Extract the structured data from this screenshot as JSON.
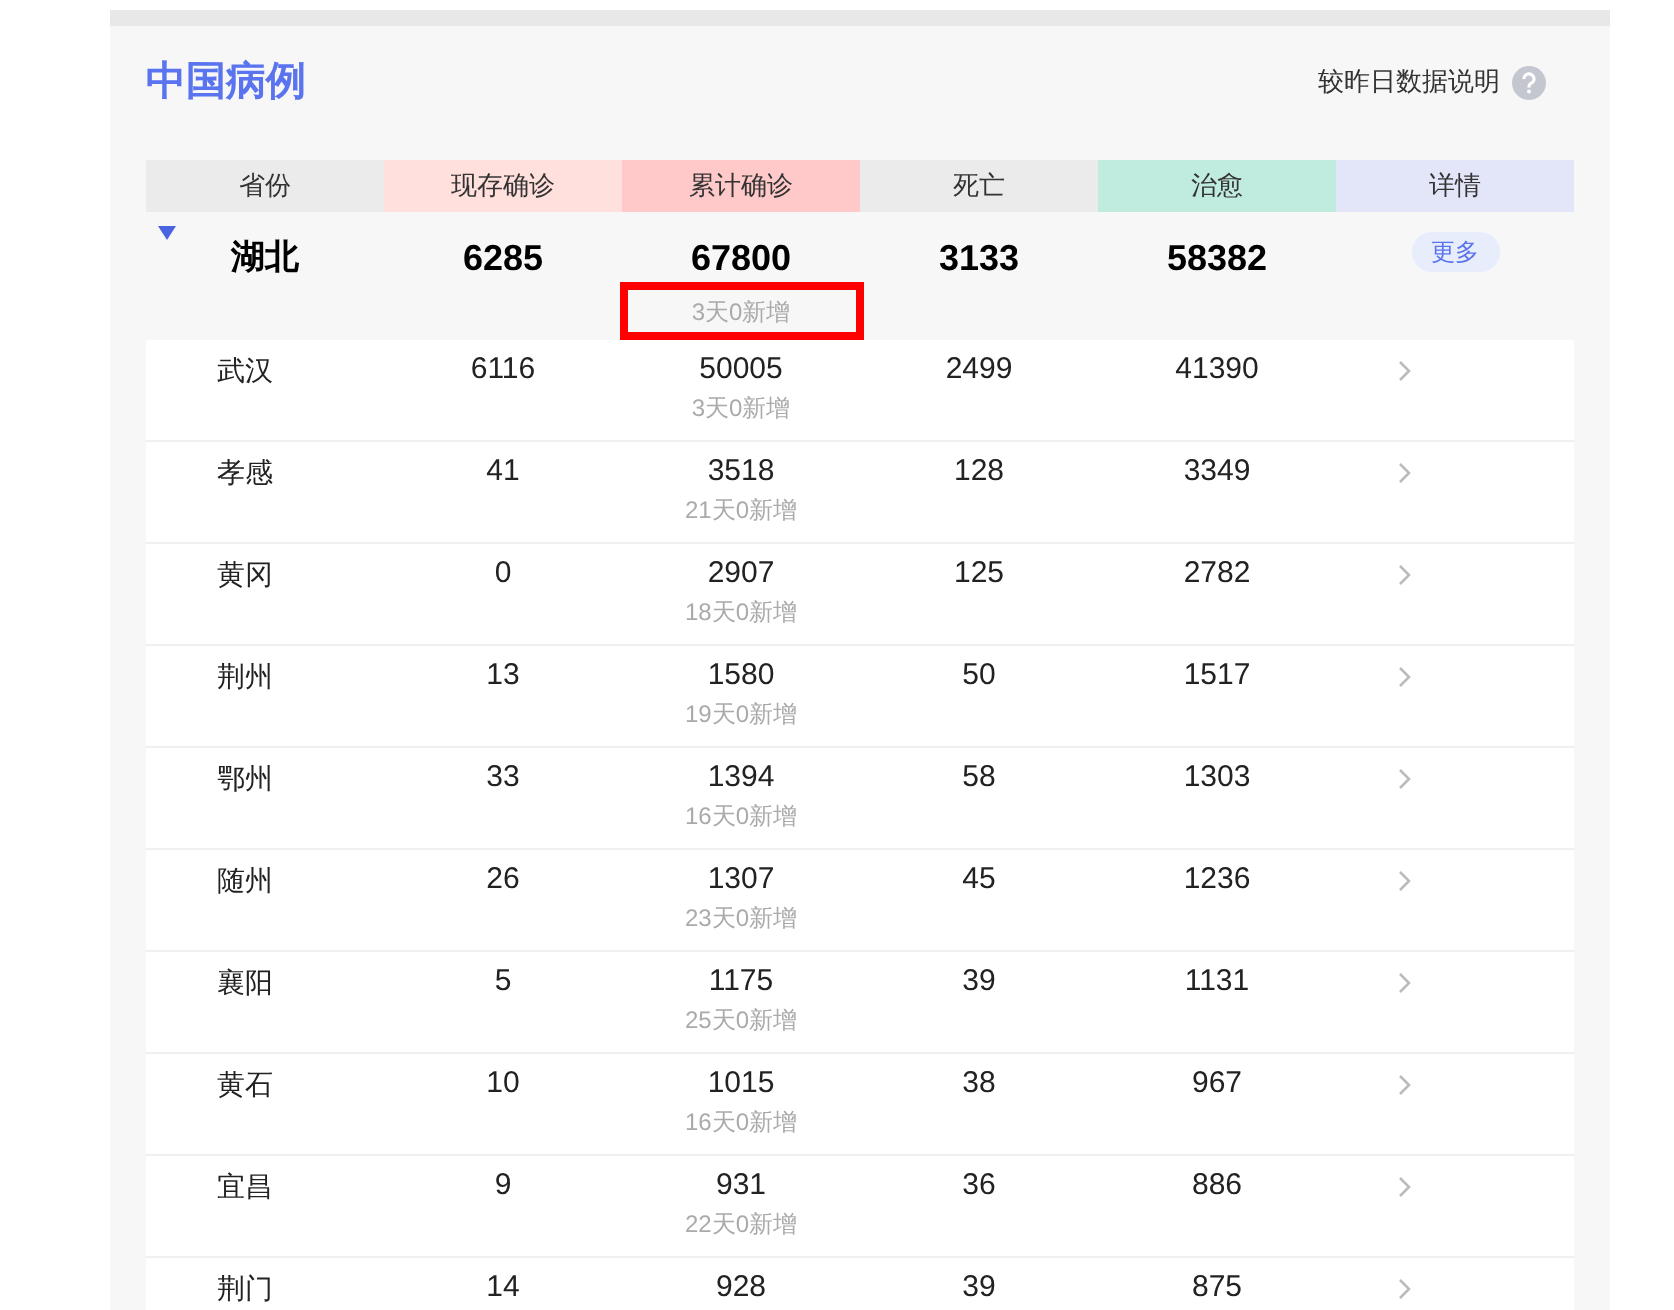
{
  "title": "中国病例",
  "explain_link": "较昨日数据说明",
  "columns": [
    {
      "label": "省份",
      "color": "#ebebeb"
    },
    {
      "label": "现存确诊",
      "color": "#ffe0dc"
    },
    {
      "label": "累计确诊",
      "color": "#ffc9c9"
    },
    {
      "label": "死亡",
      "color": "#ebebeb"
    },
    {
      "label": "治愈",
      "color": "#c0ecdf"
    },
    {
      "label": "详情",
      "color": "#e3e5f8"
    }
  ],
  "province": {
    "name": "湖北",
    "expanded": true,
    "current": "6285",
    "total": "67800",
    "note": "3天0新增",
    "note_highlighted": true,
    "deaths": "3133",
    "cured": "58382",
    "more": "更多"
  },
  "cities": [
    {
      "name": "武汉",
      "current": "6116",
      "total": "50005",
      "note": "3天0新增",
      "deaths": "2499",
      "cured": "41390"
    },
    {
      "name": "孝感",
      "current": "41",
      "total": "3518",
      "note": "21天0新增",
      "deaths": "128",
      "cured": "3349"
    },
    {
      "name": "黄冈",
      "current": "0",
      "total": "2907",
      "note": "18天0新增",
      "deaths": "125",
      "cured": "2782"
    },
    {
      "name": "荆州",
      "current": "13",
      "total": "1580",
      "note": "19天0新增",
      "deaths": "50",
      "cured": "1517"
    },
    {
      "name": "鄂州",
      "current": "33",
      "total": "1394",
      "note": "16天0新增",
      "deaths": "58",
      "cured": "1303"
    },
    {
      "name": "随州",
      "current": "26",
      "total": "1307",
      "note": "23天0新增",
      "deaths": "45",
      "cured": "1236"
    },
    {
      "name": "襄阳",
      "current": "5",
      "total": "1175",
      "note": "25天0新增",
      "deaths": "39",
      "cured": "1131"
    },
    {
      "name": "黄石",
      "current": "10",
      "total": "1015",
      "note": "16天0新增",
      "deaths": "38",
      "cured": "967"
    },
    {
      "name": "宜昌",
      "current": "9",
      "total": "931",
      "note": "22天0新增",
      "deaths": "36",
      "cured": "886"
    },
    {
      "name": "荆门",
      "current": "14",
      "total": "928",
      "deaths": "39",
      "cured": "875"
    }
  ]
}
